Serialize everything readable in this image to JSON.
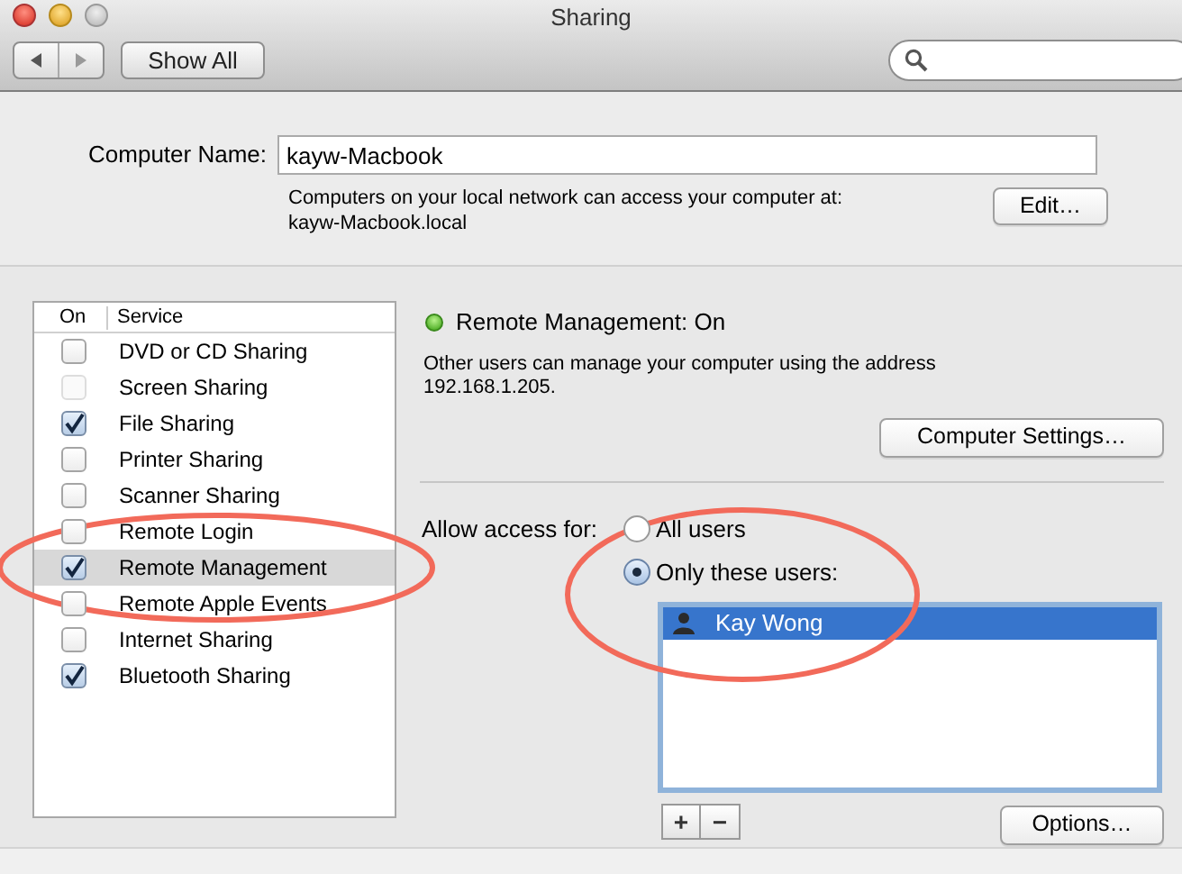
{
  "window": {
    "title": "Sharing"
  },
  "toolbar": {
    "show_all": "Show All"
  },
  "computer_name": {
    "label": "Computer Name:",
    "value": "kayw-Macbook",
    "description": [
      "Computers on your local network can access your computer at:",
      "kayw-Macbook.local"
    ],
    "edit_button": "Edit…"
  },
  "services": {
    "columns": [
      "On",
      "Service"
    ],
    "items": [
      {
        "name": "DVD or CD Sharing",
        "checked": false,
        "disabled": false,
        "selected": false
      },
      {
        "name": "Screen Sharing",
        "checked": false,
        "disabled": true,
        "selected": false
      },
      {
        "name": "File Sharing",
        "checked": true,
        "disabled": false,
        "selected": false
      },
      {
        "name": "Printer Sharing",
        "checked": false,
        "disabled": false,
        "selected": false
      },
      {
        "name": "Scanner Sharing",
        "checked": false,
        "disabled": false,
        "selected": false
      },
      {
        "name": "Remote Login",
        "checked": false,
        "disabled": false,
        "selected": false
      },
      {
        "name": "Remote Management",
        "checked": true,
        "disabled": false,
        "selected": true
      },
      {
        "name": "Remote Apple Events",
        "checked": false,
        "disabled": false,
        "selected": false
      },
      {
        "name": "Internet Sharing",
        "checked": false,
        "disabled": false,
        "selected": false
      },
      {
        "name": "Bluetooth Sharing",
        "checked": true,
        "disabled": false,
        "selected": false
      }
    ]
  },
  "status": {
    "on": true,
    "title": "Remote Management: On",
    "description": [
      "Other users can manage your computer using the address",
      "192.168.1.205."
    ],
    "settings_button": "Computer Settings…"
  },
  "access": {
    "label": "Allow access for:",
    "options": [
      {
        "label": "All users",
        "selected": false
      },
      {
        "label": "Only these users:",
        "selected": true
      }
    ],
    "users": [
      {
        "name": "Kay Wong",
        "selected": true
      }
    ],
    "add_button": "+",
    "remove_button": "−",
    "options_button": "Options…"
  }
}
